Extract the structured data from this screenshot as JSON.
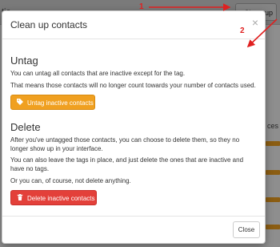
{
  "background": {
    "top_fragment": "tic",
    "cleanup_button_label": "Clean up",
    "side_fragment": "ces"
  },
  "modal": {
    "title": "Clean up contacts",
    "close_symbol": "×",
    "untag": {
      "heading": "Untag",
      "paragraph1": "You can untag all contacts that are inactive except for the tag.",
      "paragraph2": "That means those contacts will no longer count towards your number of contacts used.",
      "button_label": "Untag inactive contacts",
      "button_icon": "tag-icon"
    },
    "delete": {
      "heading": "Delete",
      "paragraph1": "After you've untagged those contacts, you can choose to delete them, so they no longer show up in your interface.",
      "paragraph2": "You can also leave the tags in place, and just delete the ones that are inactive and have no tags.",
      "paragraph3": "Or you can, of course, not delete anything.",
      "button_label": "Delete inactive contacts",
      "button_icon": "trash-icon"
    },
    "footer": {
      "close_label": "Close"
    }
  },
  "annotations": {
    "marker1": "1",
    "marker2": "2",
    "color": "#e02020"
  },
  "colors": {
    "untag_button": "#f0a020",
    "delete_button": "#e3403a"
  }
}
